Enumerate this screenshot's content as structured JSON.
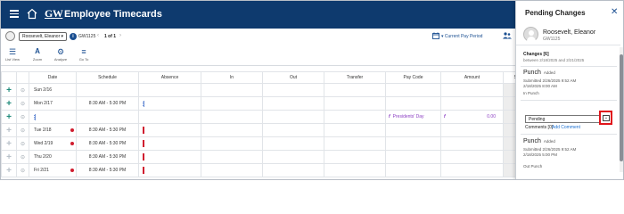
{
  "app": {
    "title": "Employee Timecards",
    "logo_text": "GW"
  },
  "icons": {
    "menu": "hamburger-menu-icon",
    "home": "home-icon",
    "calendar": "calendar-icon",
    "people": "people-icon",
    "close": "close-icon"
  },
  "toolbar": {
    "employee_value": "Roosevelt, Eleanor",
    "employee_id": "GW1125",
    "pager_text": "1 of 1",
    "pay_period": "Current Pay Period",
    "tools": [
      {
        "label": "List View",
        "icon": "list-view-icon"
      },
      {
        "label": "Zoom",
        "icon": "zoom-icon"
      },
      {
        "label": "Analyze",
        "icon": "analyze-icon"
      },
      {
        "label": "Go To",
        "icon": "go-to-icon"
      }
    ]
  },
  "grid": {
    "columns": [
      "Date",
      "Schedule",
      "Absence",
      "In",
      "Out",
      "Transfer",
      "Pay Code",
      "Amount",
      "Shift"
    ],
    "rows": [
      {
        "date": "Sun 2/16",
        "schedule": "",
        "absence": "",
        "paycode": "",
        "amount": "",
        "dot": false,
        "dim": false
      },
      {
        "date": "Mon 2/17",
        "schedule": "8:30 AM - 5:30 PM",
        "absence": "blue",
        "paycode": "",
        "amount": "",
        "dot": false,
        "dim": false
      },
      {
        "date": "",
        "schedule": "",
        "absence": "",
        "paycode": "Presidents' Day",
        "amount": "0.00",
        "dot": false,
        "dim": false,
        "date_marker": true
      },
      {
        "date": "Tue 2/18",
        "schedule": "8:30 AM - 5:30 PM",
        "absence": "red",
        "paycode": "",
        "amount": "",
        "dot": true,
        "dim": true
      },
      {
        "date": "Wed 2/19",
        "schedule": "8:30 AM - 5:30 PM",
        "absence": "red",
        "paycode": "",
        "amount": "",
        "dot": true,
        "dim": true
      },
      {
        "date": "Thu 2/20",
        "schedule": "8:30 AM - 5:30 PM",
        "absence": "red",
        "paycode": "",
        "amount": "",
        "dot": false,
        "dim": true
      },
      {
        "date": "Fri 2/21",
        "schedule": "8:30 AM - 5:30 PM",
        "absence": "red",
        "paycode": "",
        "amount": "",
        "dot": true,
        "dim": true
      }
    ]
  },
  "panel": {
    "title": "Pending Changes",
    "employee_name": "Roosevelt, Eleanor",
    "employee_id": "GW1125",
    "changes_title": "Changes [6]",
    "changes_range": "between 2/18/2025 and 2/21/2025",
    "punch1": {
      "title": "Punch",
      "tag": "Added",
      "submitted": "Submitted 2/26/2025 9:52 AM",
      "time": "2/18/2025 8:00 AM",
      "type": "In Punch"
    },
    "status_value": "Pending",
    "status_button": "⌄",
    "comments_label": "Comments [0]",
    "add_comment": "Add Comment",
    "punch2": {
      "title": "Punch",
      "tag": "Added",
      "submitted": "Submitted 2/26/2025 9:52 AM",
      "time": "2/18/2025 5:00 PM",
      "type": "Out Punch"
    }
  },
  "colors": {
    "header_bg": "#0e3a6e",
    "accent": "#1b4f91",
    "teal_plus": "#1f8a7a",
    "alert_red": "#d01d2f",
    "paycode_purple": "#8a3cc2",
    "highlight_box": "#e0151b"
  }
}
